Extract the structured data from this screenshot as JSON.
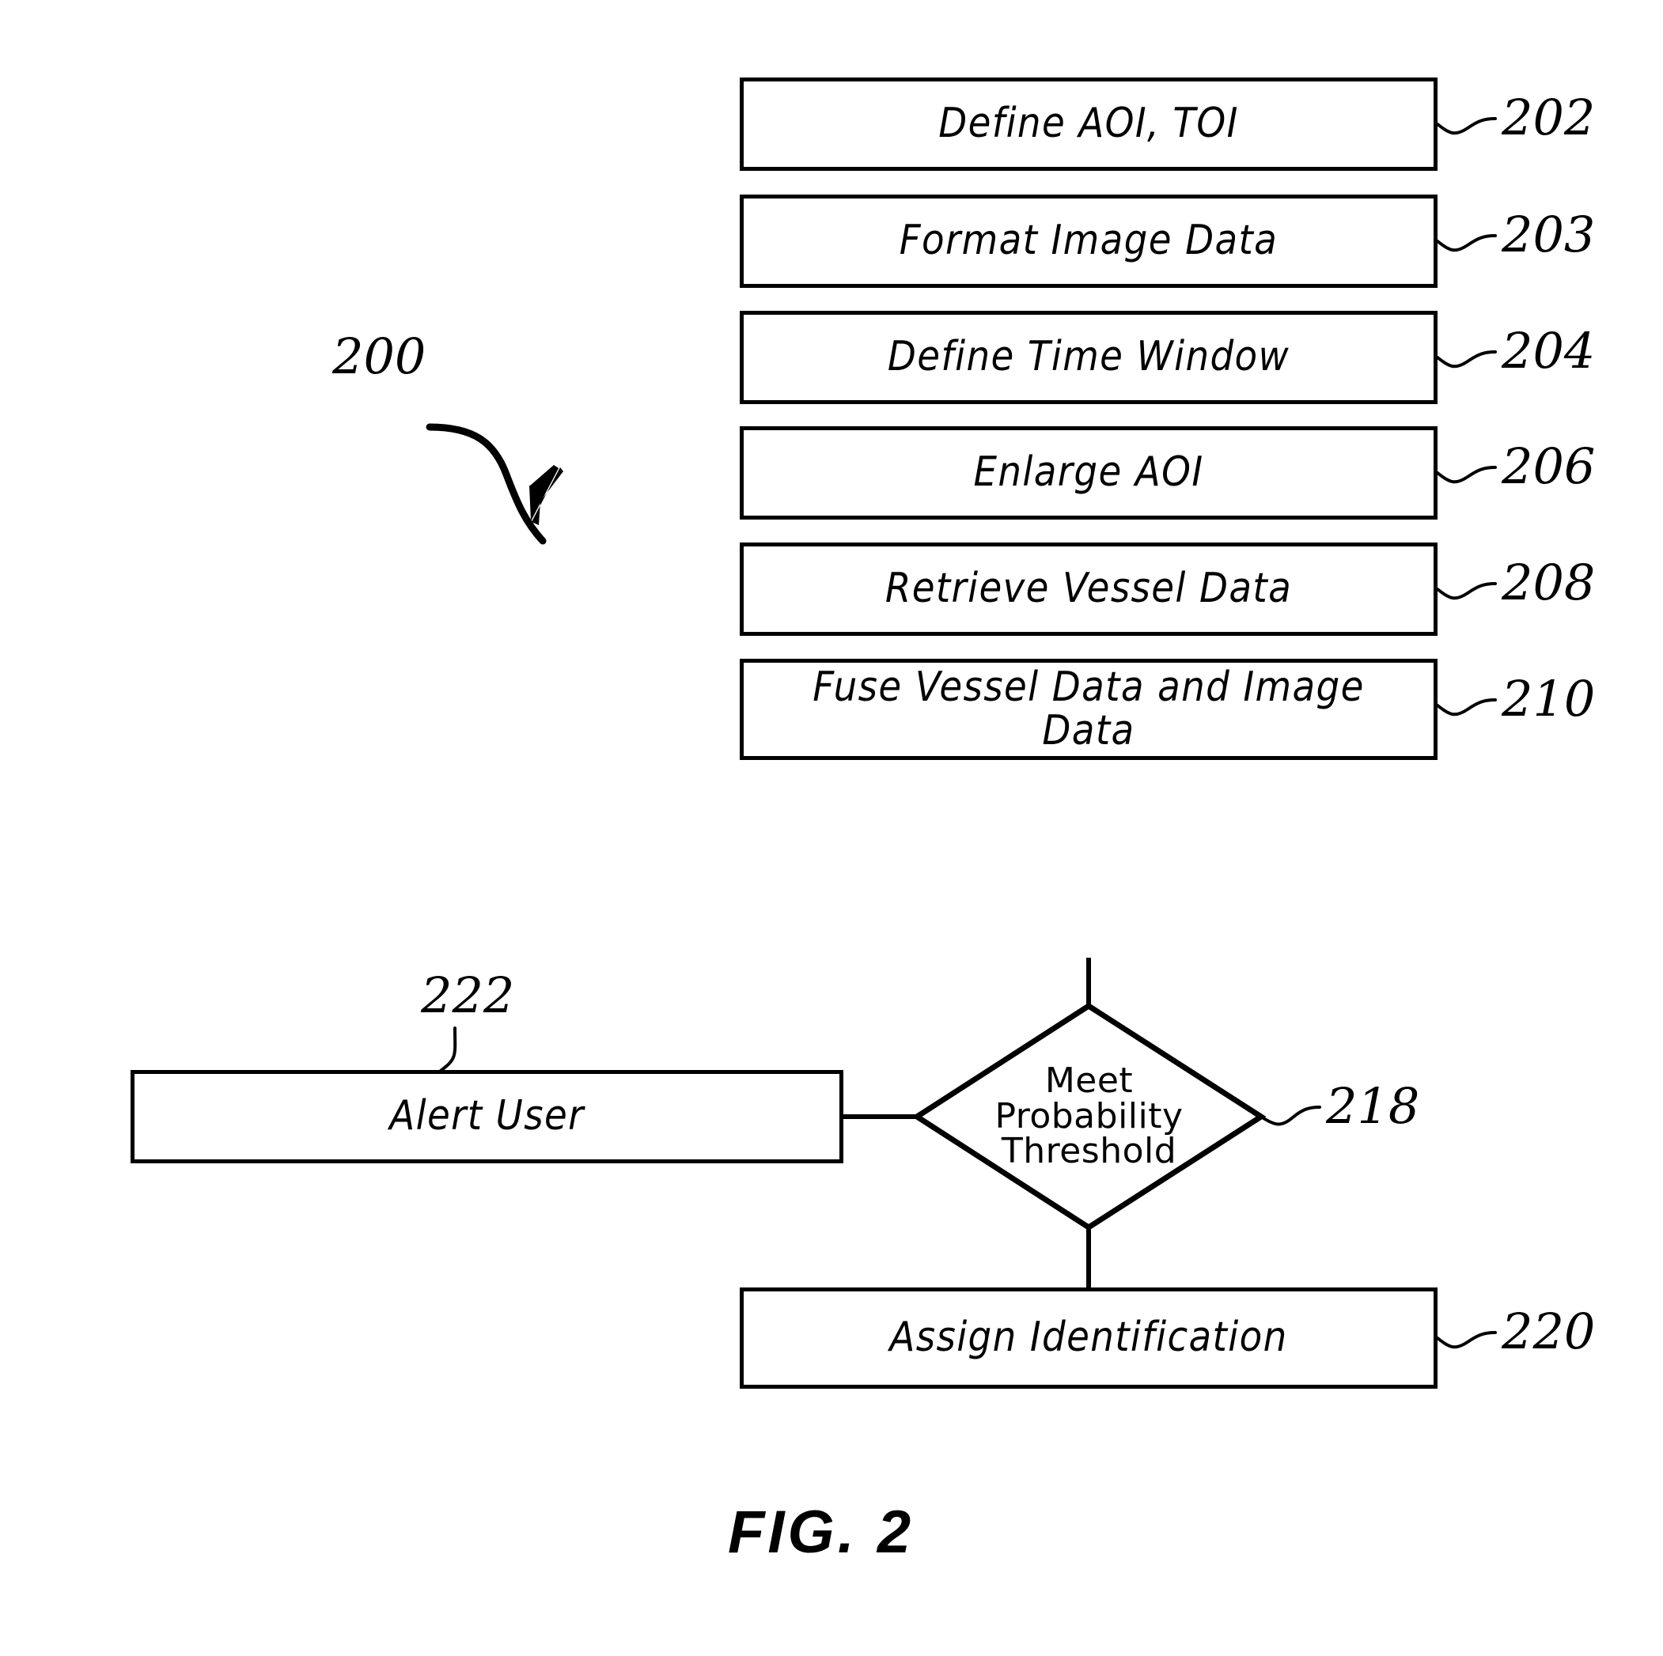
{
  "figure": {
    "caption": "FIG. 2",
    "diagram_ref": "200"
  },
  "process_steps": [
    {
      "ref": "202",
      "label": "Define AOI, TOI"
    },
    {
      "ref": "203",
      "label": "Format Image Data"
    },
    {
      "ref": "204",
      "label": "Define Time Window"
    },
    {
      "ref": "206",
      "label": "Enlarge AOI"
    },
    {
      "ref": "208",
      "label": "Retrieve Vessel Data"
    },
    {
      "ref": "210",
      "label": "Fuse Vessel Data and Image\nData"
    }
  ],
  "decision": {
    "ref": "218",
    "label": "Meet\nProbability\nThreshold"
  },
  "outcome_steps": [
    {
      "ref": "222",
      "label": "Alert User"
    },
    {
      "ref": "220",
      "label": "Assign Identification"
    }
  ],
  "colors": {
    "stroke": "#000000",
    "fill": "#ffffff"
  }
}
